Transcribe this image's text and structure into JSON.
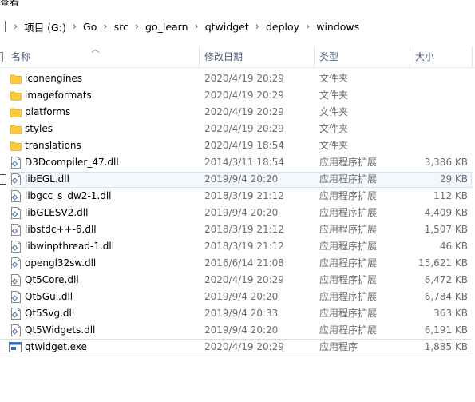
{
  "window": {
    "title_fragment": "查看"
  },
  "address": {
    "crumbs": [
      "项目 (G:)",
      "Go",
      "src",
      "go_learn",
      "qtwidget",
      "deploy",
      "windows"
    ],
    "separator": "›"
  },
  "columns": {
    "name": "名称",
    "date": "修改日期",
    "type": "类型",
    "size": "大小"
  },
  "sort": {
    "column": "name",
    "icon": "sort-up-icon"
  },
  "rows": [
    {
      "kind": "folder",
      "name": "iconengines",
      "date": "2020/4/19 20:29",
      "type": "文件夹",
      "size": ""
    },
    {
      "kind": "folder",
      "name": "imageformats",
      "date": "2020/4/19 20:29",
      "type": "文件夹",
      "size": ""
    },
    {
      "kind": "folder",
      "name": "platforms",
      "date": "2020/4/19 20:29",
      "type": "文件夹",
      "size": ""
    },
    {
      "kind": "folder",
      "name": "styles",
      "date": "2020/4/19 20:29",
      "type": "文件夹",
      "size": ""
    },
    {
      "kind": "folder",
      "name": "translations",
      "date": "2020/4/19 18:54",
      "type": "文件夹",
      "size": ""
    },
    {
      "kind": "dll",
      "name": "D3Dcompiler_47.dll",
      "date": "2014/3/11 18:54",
      "type": "应用程序扩展",
      "size": "3,386 KB"
    },
    {
      "kind": "dll",
      "name": "libEGL.dll",
      "date": "2019/9/4 20:20",
      "type": "应用程序扩展",
      "size": "29 KB",
      "selected": true
    },
    {
      "kind": "dll",
      "name": "libgcc_s_dw2-1.dll",
      "date": "2018/3/19 21:12",
      "type": "应用程序扩展",
      "size": "112 KB"
    },
    {
      "kind": "dll",
      "name": "libGLESV2.dll",
      "date": "2019/9/4 20:20",
      "type": "应用程序扩展",
      "size": "4,409 KB"
    },
    {
      "kind": "dll",
      "name": "libstdc++-6.dll",
      "date": "2018/3/19 21:12",
      "type": "应用程序扩展",
      "size": "1,507 KB"
    },
    {
      "kind": "dll",
      "name": "libwinpthread-1.dll",
      "date": "2018/3/19 21:12",
      "type": "应用程序扩展",
      "size": "46 KB"
    },
    {
      "kind": "dll",
      "name": "opengl32sw.dll",
      "date": "2016/6/14 21:08",
      "type": "应用程序扩展",
      "size": "15,621 KB"
    },
    {
      "kind": "dll",
      "name": "Qt5Core.dll",
      "date": "2020/4/19 20:29",
      "type": "应用程序扩展",
      "size": "6,472 KB"
    },
    {
      "kind": "dll",
      "name": "Qt5Gui.dll",
      "date": "2019/9/4 20:20",
      "type": "应用程序扩展",
      "size": "6,784 KB"
    },
    {
      "kind": "dll",
      "name": "Qt5Svg.dll",
      "date": "2019/9/4 20:33",
      "type": "应用程序扩展",
      "size": "363 KB"
    },
    {
      "kind": "dll",
      "name": "Qt5Widgets.dll",
      "date": "2019/9/4 20:20",
      "type": "应用程序扩展",
      "size": "6,191 KB"
    },
    {
      "kind": "exe",
      "name": "qtwidget.exe",
      "date": "2020/4/19 20:29",
      "type": "应用程序",
      "size": "1,885 KB"
    }
  ],
  "colors": {
    "folder": "#ffc83d",
    "header_text": "#4c607a",
    "secondary_text": "#6d6d6d",
    "selection": "#cce8ff"
  }
}
